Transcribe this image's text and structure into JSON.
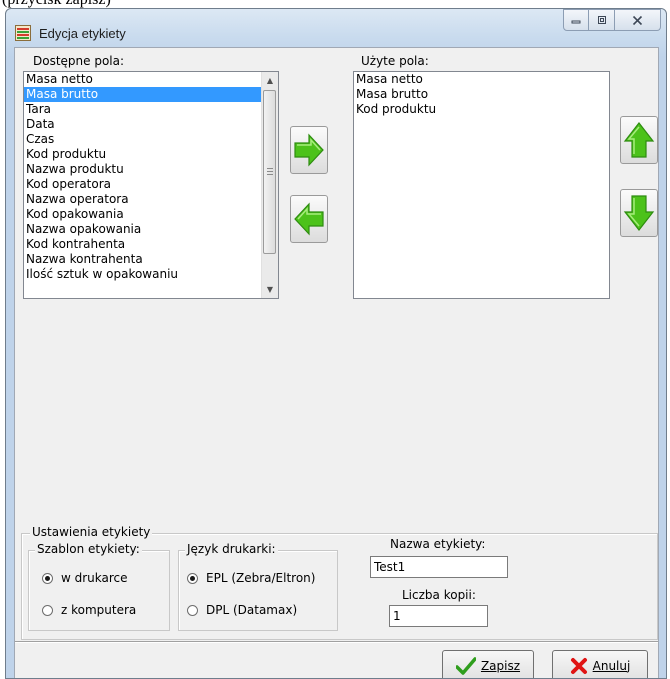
{
  "page": {
    "cut_off_text": "(przycisk zapisz)"
  },
  "window": {
    "title": "Edycja etykiety",
    "caption_buttons": {
      "minimize_icon": "minimize-icon",
      "maximize_icon": "maximize-icon",
      "close_icon": "close-icon"
    }
  },
  "available_fields": {
    "label": "Dostępne pola:",
    "items": [
      "Masa netto",
      "Masa brutto",
      "Tara",
      "Data",
      "Czas",
      "Kod produktu",
      "Nazwa produktu",
      "Kod operatora",
      "Nazwa operatora",
      "Kod opakowania",
      "Nazwa opakowania",
      "Kod kontrahenta",
      "Nazwa kontrahenta",
      "Ilość sztuk w opakowaniu"
    ],
    "selected": "Masa brutto"
  },
  "used_fields": {
    "label": "Użyte pola:",
    "items": [
      "Masa netto",
      "Masa brutto",
      "Kod produktu"
    ]
  },
  "transfer_buttons": {
    "add_icon": "arrow-right-icon",
    "remove_icon": "arrow-left-icon",
    "move_up_icon": "arrow-up-icon",
    "move_down_icon": "arrow-down-icon",
    "accent_green": "#4cc21a"
  },
  "label_settings": {
    "title": "Ustawienia etykiety",
    "template_group": {
      "title": "Szablon etykiety:",
      "options": [
        {
          "label": "w drukarce",
          "checked": true
        },
        {
          "label": "z komputera",
          "checked": false
        }
      ]
    },
    "printer_language_group": {
      "title": "Język drukarki:",
      "options": [
        {
          "label": "EPL (Zebra/Eltron)",
          "checked": true
        },
        {
          "label": "DPL (Datamax)",
          "checked": false
        }
      ]
    },
    "label_name": {
      "label": "Nazwa etykiety:",
      "value": "Test1"
    },
    "copies": {
      "label": "Liczba kopii:",
      "value": "1"
    }
  },
  "footer": {
    "save_button": {
      "label": "Zapisz",
      "icon": "checkmark-icon",
      "color": "#2f9e1d"
    },
    "cancel_button": {
      "label": "Anuluj",
      "icon": "close-x-icon",
      "color": "#e01414"
    }
  }
}
